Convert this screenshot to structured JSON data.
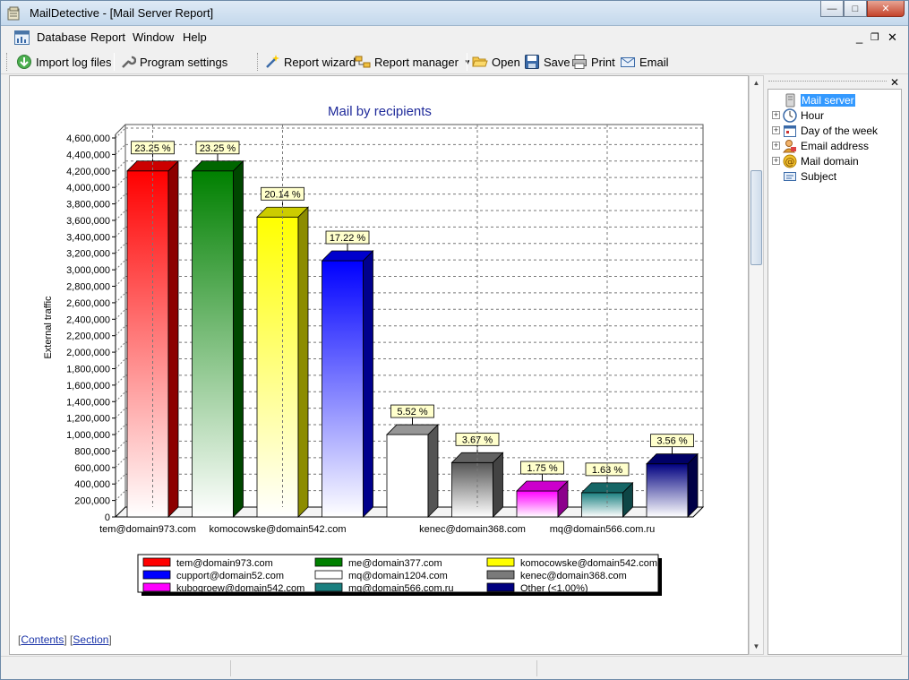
{
  "window": {
    "app_name": "MailDetective",
    "title": "MailDetective - [Mail Server Report]"
  },
  "window_controls": {
    "minimize": "—",
    "restore": "□",
    "close": "✕"
  },
  "menu": {
    "items": [
      "Database",
      "Report",
      "Window",
      "Help"
    ],
    "mdi_controls": [
      "_",
      "❐",
      "✕"
    ]
  },
  "toolbar": {
    "import": "Import log files",
    "settings": "Program settings",
    "wizard": "Report wizard",
    "manager": "Report manager",
    "open": "Open",
    "save": "Save",
    "print": "Print",
    "email": "Email"
  },
  "report_footer": {
    "contents": "Contents",
    "section": "Section"
  },
  "side_panel": {
    "close": "✕",
    "tree": [
      {
        "label": "Mail server",
        "expandable": false,
        "selected": true,
        "icon": "server-icon"
      },
      {
        "label": "Hour",
        "expandable": true,
        "selected": false,
        "icon": "clock-icon"
      },
      {
        "label": "Day of the week",
        "expandable": true,
        "selected": false,
        "icon": "calendar-icon"
      },
      {
        "label": "Email address",
        "expandable": true,
        "selected": false,
        "icon": "person-icon"
      },
      {
        "label": "Mail domain",
        "expandable": true,
        "selected": false,
        "icon": "at-icon"
      },
      {
        "label": "Subject",
        "expandable": false,
        "selected": false,
        "icon": "subject-icon"
      }
    ]
  },
  "chart_data": {
    "type": "bar",
    "title": "Mail by recipients",
    "ylabel": "External traffic",
    "xlabel": "",
    "ylim": [
      0,
      4600000
    ],
    "ytick_step": 200000,
    "y_ticks": [
      "0",
      "200,000",
      "400,000",
      "600,000",
      "800,000",
      "1,000,000",
      "1,200,000",
      "1,400,000",
      "1,600,000",
      "1,800,000",
      "2,000,000",
      "2,200,000",
      "2,400,000",
      "2,600,000",
      "2,800,000",
      "3,000,000",
      "3,200,000",
      "3,400,000",
      "3,600,000",
      "3,800,000",
      "4,000,000",
      "4,200,000",
      "4,400,000",
      "4,600,000"
    ],
    "x_tick_labels": [
      "tem@domain973.com",
      "komocowske@domain542.com",
      "kenec@domain368.com",
      "mq@domain566.com.ru"
    ],
    "x_tick_after_bar": [
      0,
      2,
      5,
      7
    ],
    "grid": true,
    "legend_position": "bottom",
    "categories": [
      "tem@domain973.com",
      "me@domain377.com",
      "komocowske@domain542.com",
      "cupport@domain52.com",
      "mq@domain1204.com",
      "kenec@domain368.com",
      "kubogroew@domain542.com",
      "mq@domain566.com.ru",
      "Other (<1.00%)"
    ],
    "values": [
      4200000,
      4200000,
      3640000,
      3110000,
      1000000,
      660000,
      315000,
      295000,
      645000
    ],
    "percent_labels": [
      "23.25 %",
      "23.25 %",
      "20.14 %",
      "17.22 %",
      "5.52 %",
      "3.67 %",
      "1.75 %",
      "1.63 %",
      "3.56 %"
    ],
    "colors": [
      "#ff0000",
      "#008000",
      "#ffff00",
      "#0000ff",
      "#ffffff",
      "#7a7a7a",
      "#ff00ff",
      "#1a8080",
      "#000080"
    ]
  }
}
